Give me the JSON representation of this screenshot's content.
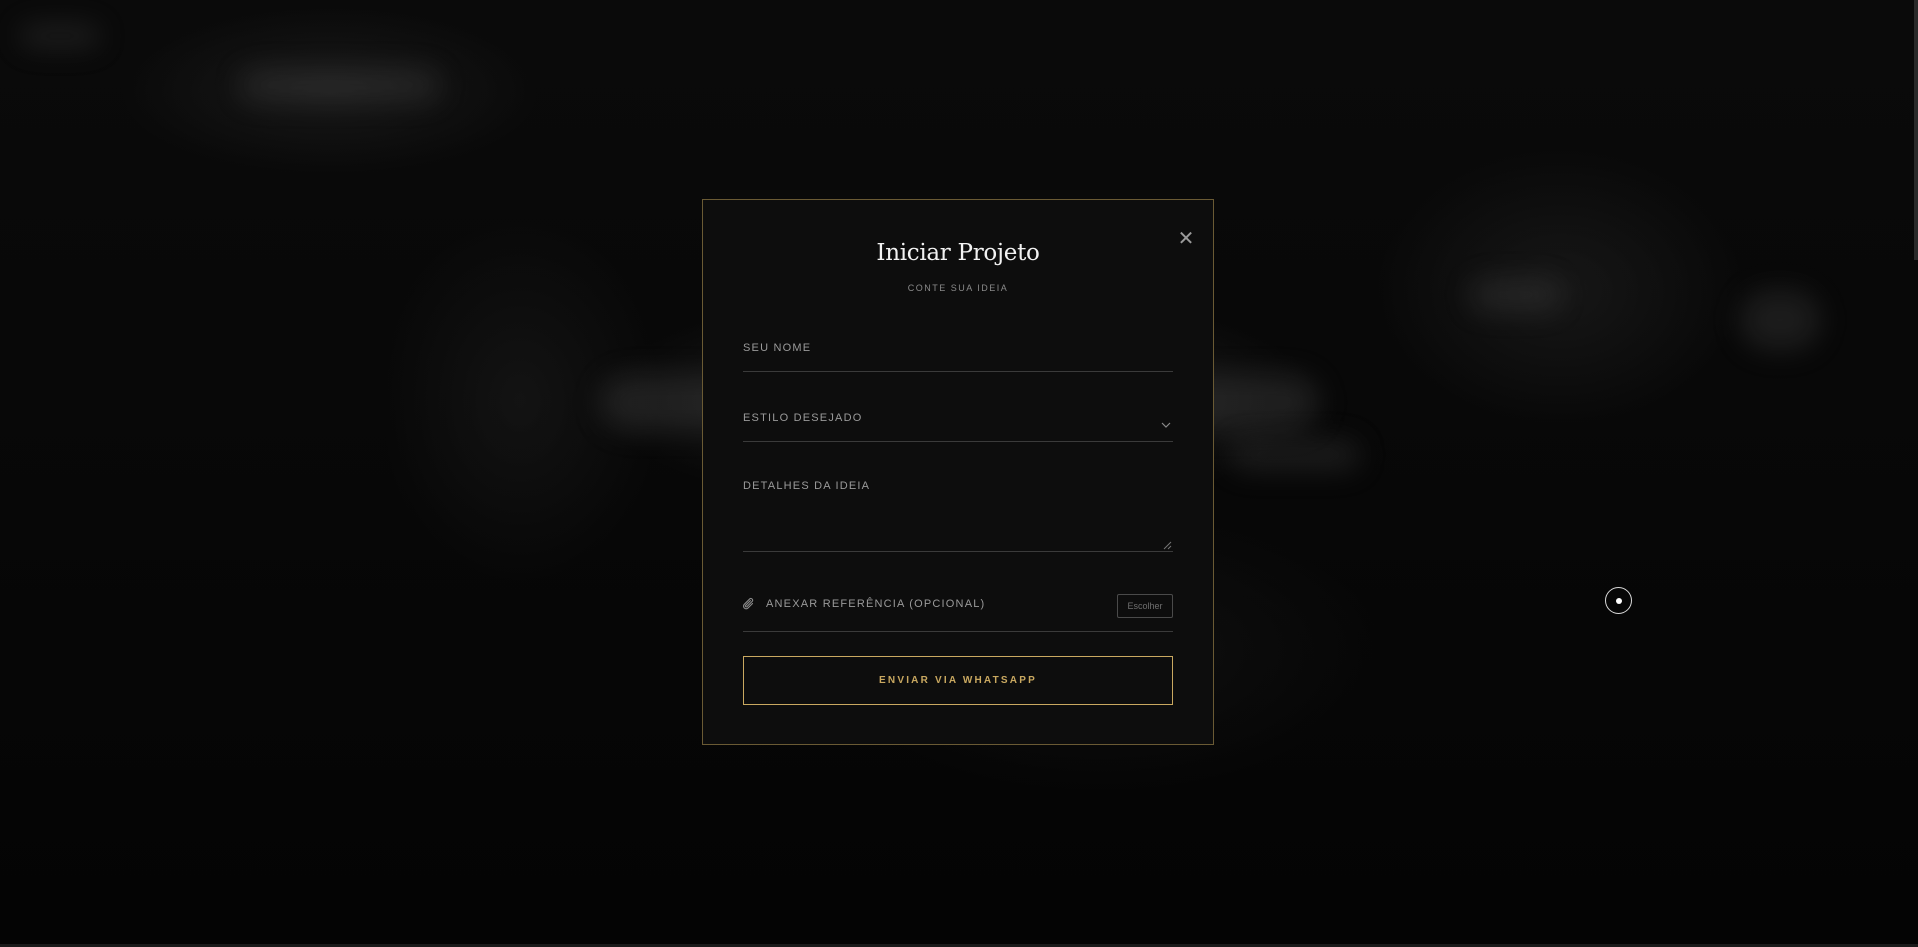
{
  "modal": {
    "title": "Iniciar Projeto",
    "subtitle": "CONTE SUA IDEIA",
    "close_icon": "close-icon",
    "close_glyph": "✕",
    "fields": {
      "name_placeholder": "SEU NOME",
      "style_placeholder": "ESTILO DESEJADO",
      "details_placeholder": "DETALHES DA IDEIA",
      "attach_label": "ANEXAR REFERÊNCIA (OPCIONAL)",
      "choose_button": "Escolher"
    },
    "submit_label": "ENVIAR VIA WHATSAPP"
  },
  "colors": {
    "accent_gold": "#c9a860",
    "modal_border": "#6a5a34",
    "modal_bg": "#0d0d0d",
    "page_bg": "#050505"
  }
}
